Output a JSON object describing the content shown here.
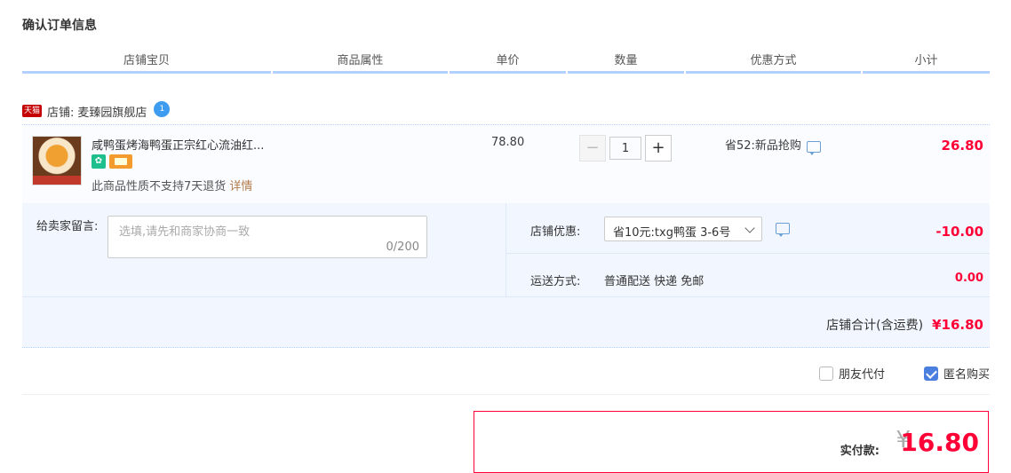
{
  "page_title": "确认订单信息",
  "columns": [
    "店铺宝贝",
    "商品属性",
    "单价",
    "数量",
    "优惠方式",
    "小计"
  ],
  "shop": {
    "badge": "天猫",
    "label": "店铺:",
    "name": "麦臻园旗舰店",
    "chat_icon": "wangwang-icon"
  },
  "item": {
    "name": "咸鸭蛋烤海鸭蛋正宗红心流油红...",
    "no_return_text": "此商品性质不支持7天退货",
    "detail_link": "详情",
    "unit_price": "78.80",
    "quantity": "1",
    "minus": "−",
    "plus": "+",
    "promotion": "省52:新品抢购",
    "subtotal": "26.80"
  },
  "message": {
    "label": "给卖家留言:",
    "placeholder": "选填,请先和商家协商一致",
    "count": "0/200"
  },
  "discount": {
    "label": "店铺优惠:",
    "selected": "省10元:txg鸭蛋 3-6号",
    "value": "-10.00"
  },
  "shipping": {
    "label": "运送方式:",
    "method": "普通配送 快递 免邮",
    "fee": "0.00"
  },
  "shop_total": {
    "label": "店铺合计(含运费)",
    "value": "¥16.80"
  },
  "options": {
    "friend_pay": {
      "label": "朋友代付",
      "checked": false
    },
    "anonymous": {
      "label": "匿名购买",
      "checked": true
    }
  },
  "payment": {
    "label": "实付款:",
    "currency": "¥",
    "amount": "16.80"
  },
  "colors": {
    "accent_red": "#ff0036",
    "header_line": "#b2d1ff",
    "checkbox_blue": "#4a7fe0"
  }
}
